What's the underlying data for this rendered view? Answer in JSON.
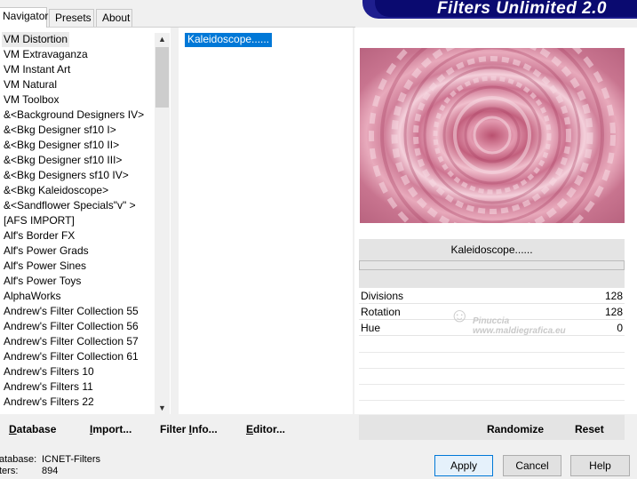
{
  "tabs": [
    {
      "label": "Navigator",
      "active": true
    },
    {
      "label": "Presets",
      "active": false
    },
    {
      "label": "About",
      "active": false
    }
  ],
  "banner": {
    "title": "Filters Unlimited 2.0"
  },
  "filter_list": {
    "items": [
      "VM Distortion",
      "VM Extravaganza",
      "VM Instant Art",
      "VM Natural",
      "VM Toolbox",
      "&<Background Designers IV>",
      "&<Bkg Designer sf10 I>",
      "&<Bkg Designer sf10 II>",
      "&<Bkg Designer sf10 III>",
      "&<Bkg Designers sf10 IV>",
      "&<Bkg Kaleidoscope>",
      "&<Sandflower Specials\"v\" >",
      "[AFS IMPORT]",
      "Alf's Border FX",
      "Alf's Power Grads",
      "Alf's Power Sines",
      "Alf's Power Toys",
      "AlphaWorks",
      "Andrew's Filter Collection 55",
      "Andrew's Filter Collection 56",
      "Andrew's Filter Collection 57",
      "Andrew's Filter Collection 61",
      "Andrew's Filters 10",
      "Andrew's Filters 11",
      "Andrew's Filters 22"
    ],
    "selected_index": 0
  },
  "effects_list": {
    "items": [
      "Kaleidoscope......"
    ],
    "selected_index": 0
  },
  "effect_panel": {
    "effect_name": "Kaleidoscope......",
    "params": [
      {
        "name": "Divisions",
        "value": "128"
      },
      {
        "name": "Rotation",
        "value": "128"
      },
      {
        "name": "Hue",
        "value": "0"
      }
    ]
  },
  "watermark": {
    "line1": "Pinuccia",
    "line2": "www.maldiegrafica.eu"
  },
  "buttons": {
    "database": {
      "label": "Database",
      "underline": "D",
      "rest": "atabase"
    },
    "import": {
      "label": "Import...",
      "underline": "I",
      "rest": "mport..."
    },
    "filter_info": {
      "label": "Filter Info...",
      "pre": "Filter ",
      "underline": "I",
      "rest": "nfo..."
    },
    "editor": {
      "label": "Editor...",
      "underline": "E",
      "rest": "ditor..."
    },
    "randomize": "Randomize",
    "reset": "Reset",
    "apply": "Apply",
    "cancel": "Cancel",
    "help": "Help"
  },
  "status": {
    "database_label": "atabase:",
    "database_value": "ICNET-Filters",
    "filters_label": "ters:",
    "filters_value": "894"
  },
  "colors": {
    "banner_bg": "#0a0a70",
    "selection": "#0078d7",
    "preview_base": "#c96b88"
  }
}
